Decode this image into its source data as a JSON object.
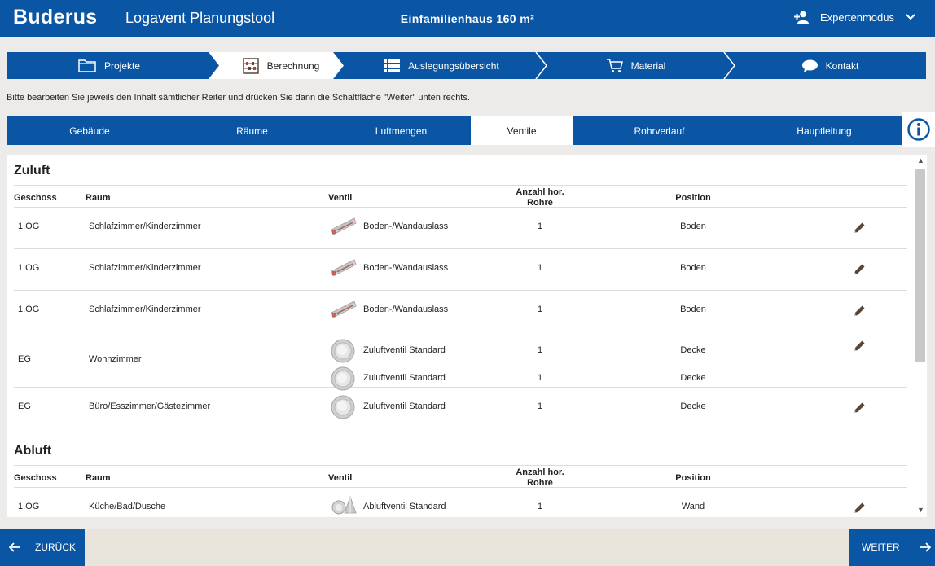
{
  "header": {
    "logo": "Buderus",
    "app_title": "Logavent Planungstool",
    "project_title": "Einfamilienhaus 160 m²",
    "expert_mode": "Expertenmodus"
  },
  "steps": [
    {
      "label": "Projekte",
      "icon": "folder-icon"
    },
    {
      "label": "Berechnung",
      "icon": "abacus-icon"
    },
    {
      "label": "Auslegungsübersicht",
      "icon": "list-icon"
    },
    {
      "label": "Material",
      "icon": "cart-icon"
    },
    {
      "label": "Kontakt",
      "icon": "chat-icon"
    }
  ],
  "instruction": "Bitte bearbeiten Sie jeweils den Inhalt sämtlicher Reiter und drücken Sie dann die Schaltfläche \"Weiter\" unten rechts.",
  "tabs": [
    "Gebäude",
    "Räume",
    "Luftmengen",
    "Ventile",
    "Rohrverlauf",
    "Hauptleitung"
  ],
  "active_tab": "Ventile",
  "columns": {
    "geschoss": "Geschoss",
    "raum": "Raum",
    "ventil": "Ventil",
    "anzahl_line1": "Anzahl hor.",
    "anzahl_line2": "Rohre",
    "position": "Position"
  },
  "zuluft": {
    "title": "Zuluft",
    "rows": [
      {
        "geschoss": "1.OG",
        "raum": "Schlafzimmer/Kinderzimmer",
        "ventile": [
          {
            "type": "boden",
            "name": "Boden-/Wandauslass",
            "anzahl": "1",
            "position": "Boden"
          }
        ]
      },
      {
        "geschoss": "1.OG",
        "raum": "Schlafzimmer/Kinderzimmer",
        "ventile": [
          {
            "type": "boden",
            "name": "Boden-/Wandauslass",
            "anzahl": "1",
            "position": "Boden"
          }
        ]
      },
      {
        "geschoss": "1.OG",
        "raum": "Schlafzimmer/Kinderzimmer",
        "ventile": [
          {
            "type": "boden",
            "name": "Boden-/Wandauslass",
            "anzahl": "1",
            "position": "Boden"
          }
        ]
      },
      {
        "geschoss": "EG",
        "raum": "Wohnzimmer",
        "ventile": [
          {
            "type": "round",
            "name": "Zuluftventil Standard",
            "anzahl": "1",
            "position": "Decke"
          },
          {
            "type": "round",
            "name": "Zuluftventil Standard",
            "anzahl": "1",
            "position": "Decke"
          }
        ]
      },
      {
        "geschoss": "EG",
        "raum": "Büro/Esszimmer/Gästezimmer",
        "ventile": [
          {
            "type": "round",
            "name": "Zuluftventil Standard",
            "anzahl": "1",
            "position": "Decke"
          }
        ]
      }
    ]
  },
  "abluft": {
    "title": "Abluft",
    "rows": [
      {
        "geschoss": "1.OG",
        "raum": "Küche/Bad/Dusche",
        "ventile": [
          {
            "type": "abluft",
            "name": "Abluftventil Standard",
            "anzahl": "1",
            "position": "Wand"
          }
        ]
      }
    ]
  },
  "footer": {
    "back": "ZURÜCK",
    "next": "WEITER"
  },
  "colors": {
    "primary": "#0b56a4",
    "background": "#ecebe9",
    "footer": "#e9e4dc",
    "edit_icon": "#5a4636"
  }
}
